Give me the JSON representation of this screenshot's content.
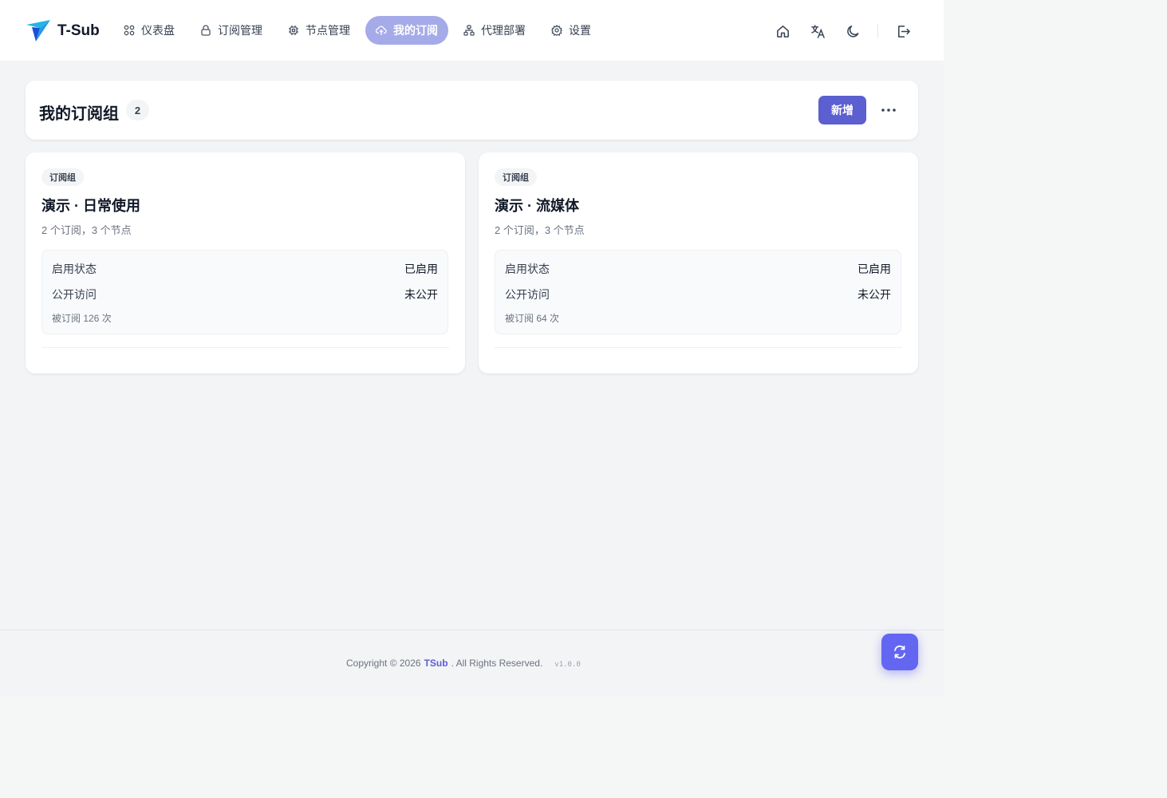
{
  "app": {
    "name": "T-Sub"
  },
  "nav": [
    {
      "key": "dashboard",
      "label": "仪表盘",
      "icon": "grid-icon"
    },
    {
      "key": "subscriptions",
      "label": "订阅管理",
      "icon": "lock-icon"
    },
    {
      "key": "nodes",
      "label": "节点管理",
      "icon": "chip-icon"
    },
    {
      "key": "mysub",
      "label": "我的订阅",
      "icon": "cloud-upload-icon",
      "active": true
    },
    {
      "key": "proxy",
      "label": "代理部署",
      "icon": "sitemap-icon"
    },
    {
      "key": "settings",
      "label": "设置",
      "icon": "gear-icon"
    }
  ],
  "page": {
    "title": "我的订阅组",
    "count": "2",
    "add_label": "新增"
  },
  "cards": [
    {
      "tag": "订阅组",
      "title": "演示 · 日常使用",
      "subtitle": "2 个订阅，3 个节点",
      "status_label": "启用状态",
      "status_value": "已启用",
      "public_label": "公开访问",
      "public_value": "未公开",
      "sub_count_text": "被订阅 126 次"
    },
    {
      "tag": "订阅组",
      "title": "演示 · 流媒体",
      "subtitle": "2 个订阅，3 个节点",
      "status_label": "启用状态",
      "status_value": "已启用",
      "public_label": "公开访问",
      "public_value": "未公开",
      "sub_count_text": "被订阅 64 次"
    }
  ],
  "footer": {
    "copyright_prefix": "Copyright © 2026",
    "brand": "TSub",
    "copyright_suffix": ". All Rights Reserved.",
    "version": "v1.0.0"
  },
  "colors": {
    "accent": "#5b5fcf",
    "active_nav": "#a5aae8",
    "fab": "#6366f1"
  }
}
